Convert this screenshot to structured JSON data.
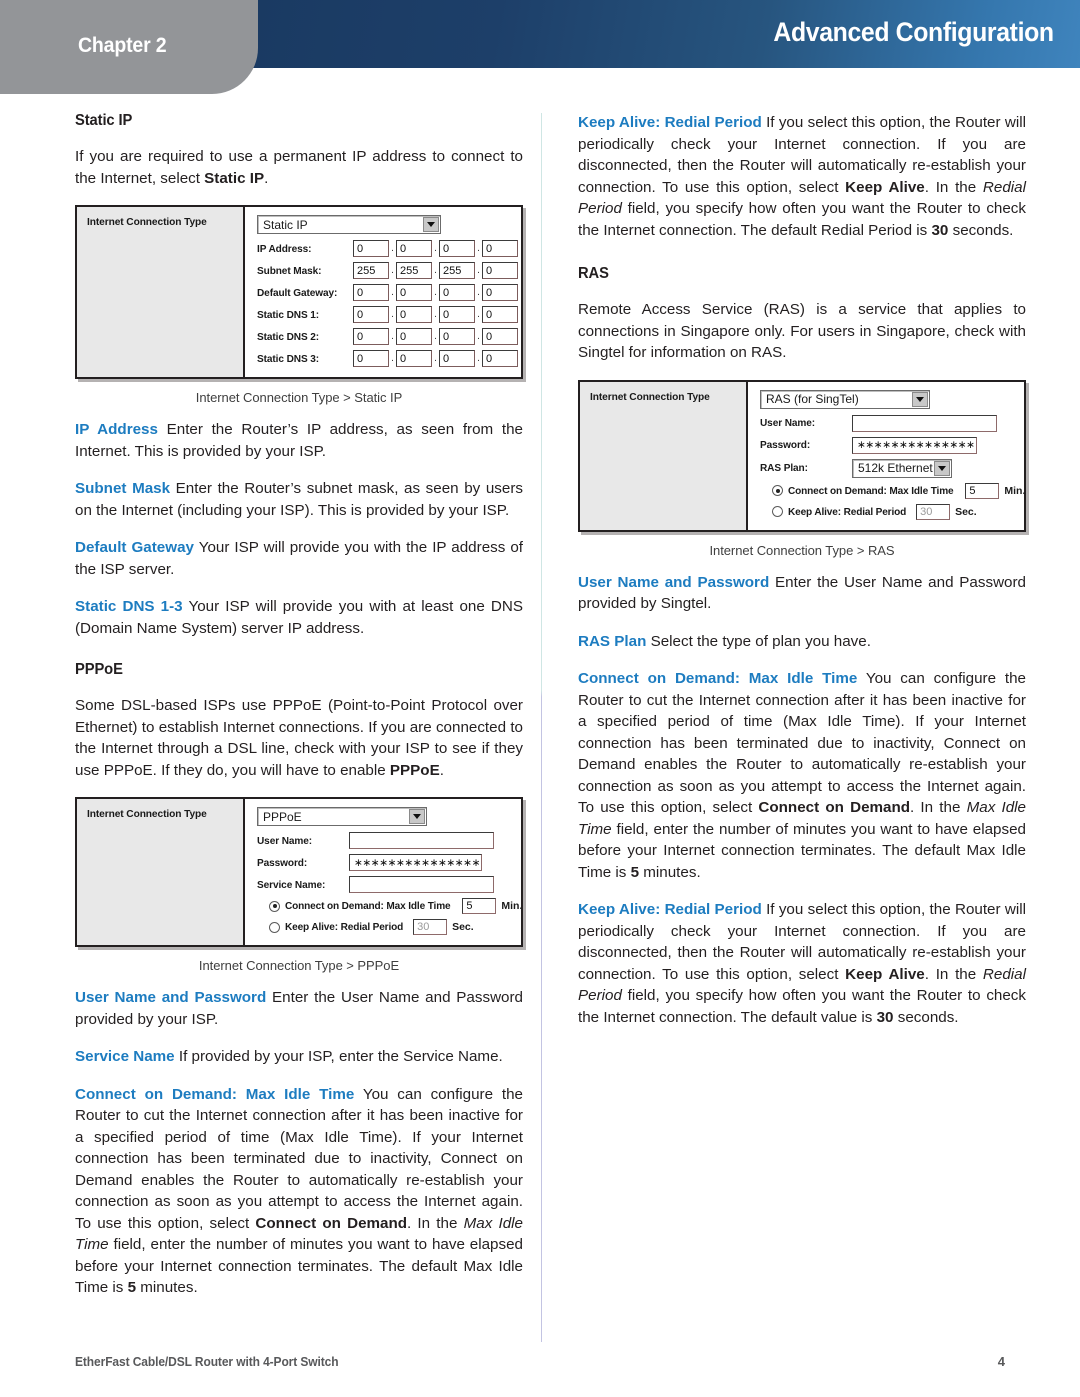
{
  "header": {
    "chapter_label": "Chapter 2",
    "banner_title": "Advanced Configuration",
    "banner_color_start": "#1a3a62",
    "banner_color_end": "#3f84bd",
    "tab_color": "#939598"
  },
  "accent_color": "#1d7cc0",
  "left_column": {
    "static_ip": {
      "heading": "Static IP",
      "intro_a": "If you are required to use a permanent IP address to connect to the Internet, select ",
      "intro_bold": "Static IP",
      "intro_b": ".",
      "figure": {
        "panel_label": "Internet Connection Type",
        "select_value": "Static IP",
        "rows": [
          {
            "label": "IP Address:",
            "octets": [
              "0",
              "0",
              "0",
              "0"
            ]
          },
          {
            "label": "Subnet Mask:",
            "octets": [
              "255",
              "255",
              "255",
              "0"
            ]
          },
          {
            "label": "Default Gateway:",
            "octets": [
              "0",
              "0",
              "0",
              "0"
            ]
          },
          {
            "label": "Static DNS 1:",
            "octets": [
              "0",
              "0",
              "0",
              "0"
            ]
          },
          {
            "label": "Static DNS 2:",
            "octets": [
              "0",
              "0",
              "0",
              "0"
            ]
          },
          {
            "label": "Static DNS 3:",
            "octets": [
              "0",
              "0",
              "0",
              "0"
            ]
          }
        ],
        "caption": "Internet Connection Type > Static IP"
      },
      "defs": [
        {
          "lead": "IP Address",
          "text": "  Enter the Router’s IP address, as seen from the Internet. This is provided by your ISP."
        },
        {
          "lead": "Subnet Mask",
          "text": "  Enter the Router’s subnet mask, as seen by users on the Internet (including your ISP). This is provided by your ISP."
        },
        {
          "lead": "Default Gateway",
          "text": "  Your ISP will provide you with the IP address of the ISP server."
        },
        {
          "lead": "Static DNS 1-3",
          "text": "  Your ISP will provide you with at least one DNS (Domain Name System) server IP address."
        }
      ]
    },
    "pppoe": {
      "heading": "PPPoE",
      "intro_a": "Some DSL-based ISPs use PPPoE (Point-to-Point Protocol over Ethernet) to establish Internet connections. If you are connected to the Internet through a DSL line, check with your ISP to see if they use PPPoE. If they do, you will have to enable ",
      "intro_bold": "PPPoE",
      "intro_b": ".",
      "figure": {
        "panel_label": "Internet Connection Type",
        "select_value": "PPPoE",
        "fields": [
          {
            "label": "User Name:",
            "value": ""
          },
          {
            "label": "Password:",
            "value": "∗∗∗∗∗∗∗∗∗∗∗∗∗∗∗∗∗"
          },
          {
            "label": "Service Name:",
            "value": ""
          }
        ],
        "radio_connect": {
          "label": "Connect on Demand: Max Idle Time",
          "value": "5",
          "unit": "Min.",
          "selected": true
        },
        "radio_keepalive": {
          "label": "Keep Alive: Redial Period",
          "value": "30",
          "unit": "Sec.",
          "selected": false
        },
        "caption": "Internet Connection Type > PPPoE"
      },
      "defs": [
        {
          "lead": "User Name and Password",
          "text": "  Enter the User Name and Password provided by your ISP."
        },
        {
          "lead": "Service Name",
          "text": "  If provided by your ISP, enter the Service Name."
        }
      ],
      "connect_on_demand": {
        "lead": "Connect on Demand: Max Idle Time",
        "p1": "  You can configure the Router to cut the Internet connection after it has been inactive for a specified period of time (Max Idle Time). If your Internet connection has been terminated due to inactivity, Connect on Demand enables the Router to automatically re-establish your connection as soon as you attempt to access the Internet again. To use this option, select ",
        "bold1": "Connect on Demand",
        "p2": ". In the ",
        "ital1": "Max Idle Time",
        "p3": " field, enter the number of minutes you want to have elapsed before your Internet connection terminates. The default Max Idle Time is ",
        "bold2": "5",
        "p4": " minutes."
      }
    }
  },
  "right_column": {
    "keep_alive_top": {
      "lead": "Keep Alive: Redial Period",
      "p1": " If you select this option, the Router will periodically check your Internet connection. If you are disconnected, then the Router will automatically re-establish your connection. To use this option, select ",
      "bold1": "Keep Alive",
      "p2": ". In the ",
      "ital1": "Redial Period",
      "p3": " field, you specify how often you want the Router to check the Internet connection. The default Redial Period is ",
      "bold2": "30",
      "p4": " seconds."
    },
    "ras": {
      "heading": "RAS",
      "intro": "Remote Access Service (RAS) is a service that applies to connections in Singapore only. For users in Singapore, check with Singtel for information on RAS.",
      "figure": {
        "panel_label": "Internet Connection Type",
        "select_value": "RAS (for SingTel)",
        "fields": [
          {
            "label": "User Name:",
            "value": ""
          },
          {
            "label": "Password:",
            "value": "∗∗∗∗∗∗∗∗∗∗∗∗∗∗∗∗"
          }
        ],
        "ras_plan_label": "RAS Plan:",
        "ras_plan_value": "512k Ethernet",
        "radio_connect": {
          "label": "Connect on Demand: Max Idle Time",
          "value": "5",
          "unit": "Min.",
          "selected": true
        },
        "radio_keepalive": {
          "label": "Keep Alive: Redial Period",
          "value": "30",
          "unit": "Sec.",
          "selected": false
        },
        "caption": "Internet Connection Type > RAS"
      },
      "defs": [
        {
          "lead": "User Name and Password",
          "text": "  Enter the User Name and Password provided by Singtel."
        },
        {
          "lead": "RAS Plan",
          "text": "  Select the type of plan you have."
        }
      ],
      "connect_on_demand": {
        "lead": "Connect on Demand: Max Idle Time",
        "p1": "  You can configure the Router to cut the Internet connection after it has been inactive for a specified period of time (Max Idle Time). If your Internet connection has been terminated due to inactivity, Connect on Demand enables the Router to automatically re-establish your connection as soon as you attempt to access the Internet again. To use this option, select ",
        "bold1": "Connect on Demand",
        "p2": ". In the ",
        "ital1": "Max Idle Time",
        "p3": " field, enter the number of minutes you want to have elapsed before your Internet connection terminates. The default Max Idle Time is ",
        "bold2": "5",
        "p4": " minutes."
      },
      "keep_alive": {
        "lead": "Keep Alive: Redial Period",
        "p1": "  If you select this option, the Router will periodically check your Internet connection. If you are disconnected, then the Router will automatically re-establish your connection. To use this option, select ",
        "bold1": "Keep Alive",
        "p2": ". In the ",
        "ital1": "Redial Period",
        "p3": " field, you specify how often you want the Router to check the Internet connection. The default value is ",
        "bold2": "30",
        "p4": " seconds."
      }
    }
  },
  "footer": {
    "product": "EtherFast Cable/DSL Router with 4-Port Switch",
    "page_number": "4"
  }
}
